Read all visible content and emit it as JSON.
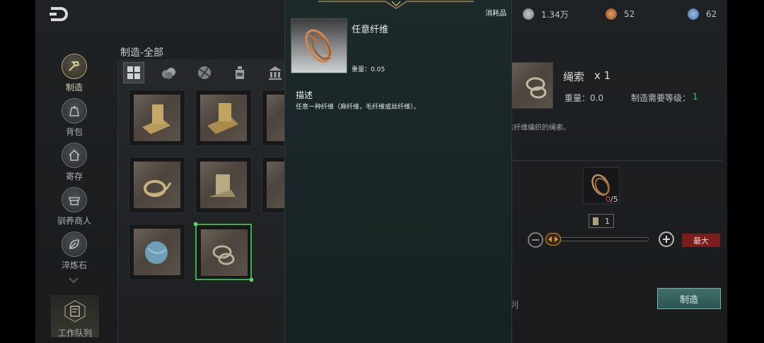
{
  "sidebar": {
    "items": [
      {
        "label": "制造",
        "icon": "hammer-icon"
      },
      {
        "label": "背包",
        "icon": "bag-icon"
      },
      {
        "label": "寄存",
        "icon": "house-icon"
      },
      {
        "label": "驯养商人",
        "icon": "merchant-icon"
      },
      {
        "label": "淬炼石",
        "icon": "leaf-stone-icon"
      }
    ],
    "queue_label": "工作队列"
  },
  "craft": {
    "title": "制造-全部",
    "tabs": [
      "grid-icon",
      "materials-icon",
      "ball-icon",
      "bottle-icon",
      "building-icon"
    ]
  },
  "currencies": [
    {
      "value": "1.34万",
      "color": "#9aa3a8"
    },
    {
      "value": "52",
      "color": "#c9743a"
    },
    {
      "value": "62",
      "color": "#5a86b8"
    }
  ],
  "detail": {
    "name": "绳索",
    "qty": "x 1",
    "weight": "重量：0.0",
    "level_label": "制造需要等级：",
    "level_value": "1",
    "description": "意纤维编织的绳索。",
    "material_have": "0",
    "material_need": "/5",
    "amount": "1",
    "max_label": "最大",
    "view_queue_label": "查看队列",
    "craft_label": "制造"
  },
  "tooltip": {
    "category": "消耗品",
    "name": "任意纤维",
    "weight": "重量：0.05",
    "desc_title": "描述",
    "desc": "任意一种纤维（麻纤维，毛纤维或丝纤维）。"
  }
}
